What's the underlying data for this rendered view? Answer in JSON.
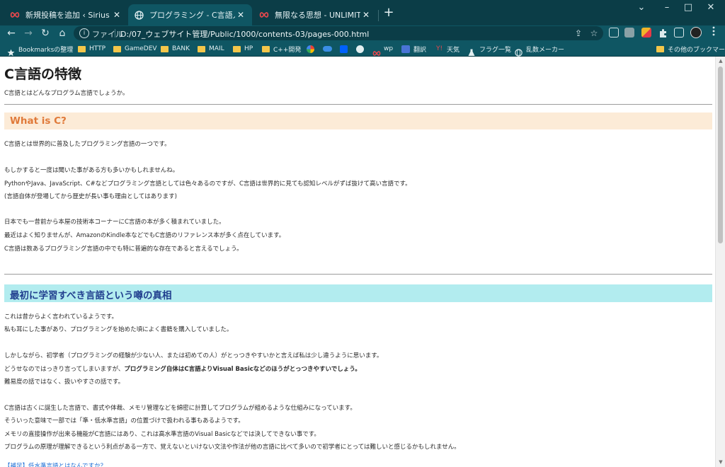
{
  "browser": {
    "tabs": [
      {
        "title": "新規投稿を追加 ‹ Sirius X — Word",
        "favicon": "infinity-icon",
        "active": false
      },
      {
        "title": "プログラミング - C言語入門",
        "favicon": "globe-icon",
        "active": true
      },
      {
        "title": "無限なる思想 - UNLIMITED LOOP",
        "favicon": "infinity-icon",
        "active": false
      }
    ],
    "close_glyph": "✕",
    "new_tab_glyph": "+",
    "window_controls": [
      "⌄",
      "–",
      "□",
      "✕"
    ],
    "nav": {
      "back": "←",
      "forward": "→",
      "reload": "↻",
      "home": "⌂"
    },
    "address": {
      "scheme_label": "ファイル",
      "url": "D:/07_ウェブサイト管理/Public/1000/contents-03/pages-000.html",
      "info_glyph": "i",
      "share_glyph": "⇪",
      "star_glyph": "☆"
    },
    "bookmarks": [
      {
        "label": "Bookmarksの整理",
        "icon": "star-icon"
      },
      {
        "label": "HTTP",
        "icon": "folder-icon"
      },
      {
        "label": "GameDEV",
        "icon": "folder-icon"
      },
      {
        "label": "BANK",
        "icon": "folder-icon"
      },
      {
        "label": "MAIL",
        "icon": "folder-icon"
      },
      {
        "label": "HP",
        "icon": "folder-icon"
      },
      {
        "label": "C++開発",
        "icon": "folder-icon"
      },
      {
        "label": "",
        "icon": "google-icon"
      },
      {
        "label": "",
        "icon": "cloud-icon"
      },
      {
        "label": "",
        "icon": "dropbox-icon"
      },
      {
        "label": "",
        "icon": "github-icon"
      },
      {
        "label": "wp",
        "icon": "infinity-icon"
      },
      {
        "label": "翻訳",
        "icon": "translate-icon"
      },
      {
        "label": "天気",
        "icon": "weather-icon"
      },
      {
        "label": "フラグ一覧",
        "icon": "flask-icon"
      },
      {
        "label": "乱数メーカー",
        "icon": "globe-icon"
      }
    ],
    "other_bookmarks": "その他のブックマーク"
  },
  "page": {
    "title": "C言語の特徴",
    "intro": "C言語とはどんなプログラム言語でしょうか。",
    "section1": {
      "heading": "What is C?",
      "lines": [
        "C言語とは世界的に普及したプログラミング言語の一つです。",
        "もしかすると一度は聞いた事がある方も多いかもしれませんね。",
        "PythonやJava、JavaScript、C#などプログラミング言語としては色々あるのですが、C言語は世界的に見ても認知レベルがずば抜けて高い言語です。",
        "(言語自体が登場してから歴史が長い事も理由としてはあります)",
        "日本でも一昔前から本屋の技術本コーナーにC言語の本が多く積まれていました。",
        "最近はよく知りませんが、AmazonのKindle本などでもC言語のリファレンス本が多く点在しています。",
        "C言語は数あるプログラミング言語の中でも特に普遍的な存在であると言えるでしょう。"
      ]
    },
    "section2": {
      "heading": "最初に学習すべき言語という噂の真相",
      "lines": [
        "これは昔からよく言われているようです。",
        "私も耳にした事があり、プログラミングを始めた頃によく書籍を購入していました。",
        "しかしながら、初学者（プログラミングの経験が少ない人、または初めての人）がとっつきやすいかと言えば私は少し違うように思います。",
        "どうせなのではっきり言ってしまいますが、",
        "プログラミング自体はC言語よりVisual Basicなどのほうがとっつきやすいでしょう。",
        "難易度の話ではなく、扱いやすさの話です。",
        "C言語は古くに誕生した言語で、書式や体裁、メモリ管理などを綿密に計算してプログラムが組めるような仕組みになっています。",
        "そういった意味で一部では「準・低水準言語」の位置づけで扱われる事もあるようです。",
        "メモリの直接操作が出来る機能がC言語にはあり、これは高水準言語のVisual Basicなどでは決してできない事です。",
        "プログラムの原理が理解できるという利点がある一方で、覚えないといけない文法や作法が他の言語に比べて多いので初学者にとっては難しいと感じるかもしれません。"
      ],
      "link": "【補足】低水準言語とはなんですか？"
    }
  }
}
